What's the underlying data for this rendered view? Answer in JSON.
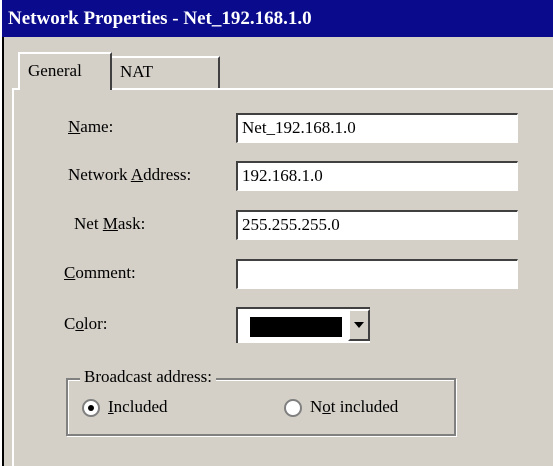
{
  "window": {
    "title": "Network Properties - Net_192.168.1.0"
  },
  "tabs": [
    {
      "label": "General",
      "selected": true
    },
    {
      "label": "NAT",
      "selected": false
    }
  ],
  "form": {
    "name": {
      "label_u": "N",
      "label_rest": "ame:",
      "value": "Net_192.168.1.0"
    },
    "address": {
      "label_pre": "Network ",
      "label_u": "A",
      "label_rest": "ddress:",
      "value": "192.168.1.0"
    },
    "mask": {
      "label_pre": "Net ",
      "label_u": "M",
      "label_rest": "ask:",
      "value": "255.255.255.0"
    },
    "comment": {
      "label_u": "C",
      "label_rest": "omment:",
      "value": ""
    },
    "color": {
      "label_pre": "C",
      "label_u": "o",
      "label_rest": "lor:",
      "value_color": "#000000"
    }
  },
  "broadcast": {
    "legend": "Broadcast address:",
    "options": [
      {
        "label_u": "I",
        "label_rest": "ncluded",
        "selected": true
      },
      {
        "label_pre": "N",
        "label_u": "o",
        "label_rest": "t included",
        "selected": false
      }
    ]
  },
  "colors": {
    "titlebar": "#0a0a8c",
    "face": "#d4d0c8"
  }
}
